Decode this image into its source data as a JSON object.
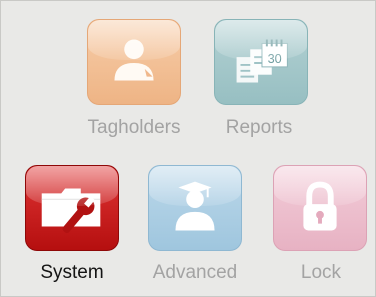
{
  "menu": {
    "items": [
      {
        "label": "Tagholders",
        "icon": "user-icon",
        "color": "#f2c29a",
        "state": "disabled"
      },
      {
        "label": "Reports",
        "icon": "calendar-report-icon",
        "color": "#a6c9cc",
        "state": "disabled"
      },
      {
        "label": "System",
        "icon": "folder-wrench-icon",
        "color": "#cc1f1f",
        "state": "active"
      },
      {
        "label": "Advanced",
        "icon": "graduate-user-icon",
        "color": "#aed0e6",
        "state": "disabled"
      },
      {
        "label": "Lock",
        "icon": "padlock-icon",
        "color": "#eec1cf",
        "state": "disabled"
      }
    ],
    "reports_calendar_day": "30"
  }
}
